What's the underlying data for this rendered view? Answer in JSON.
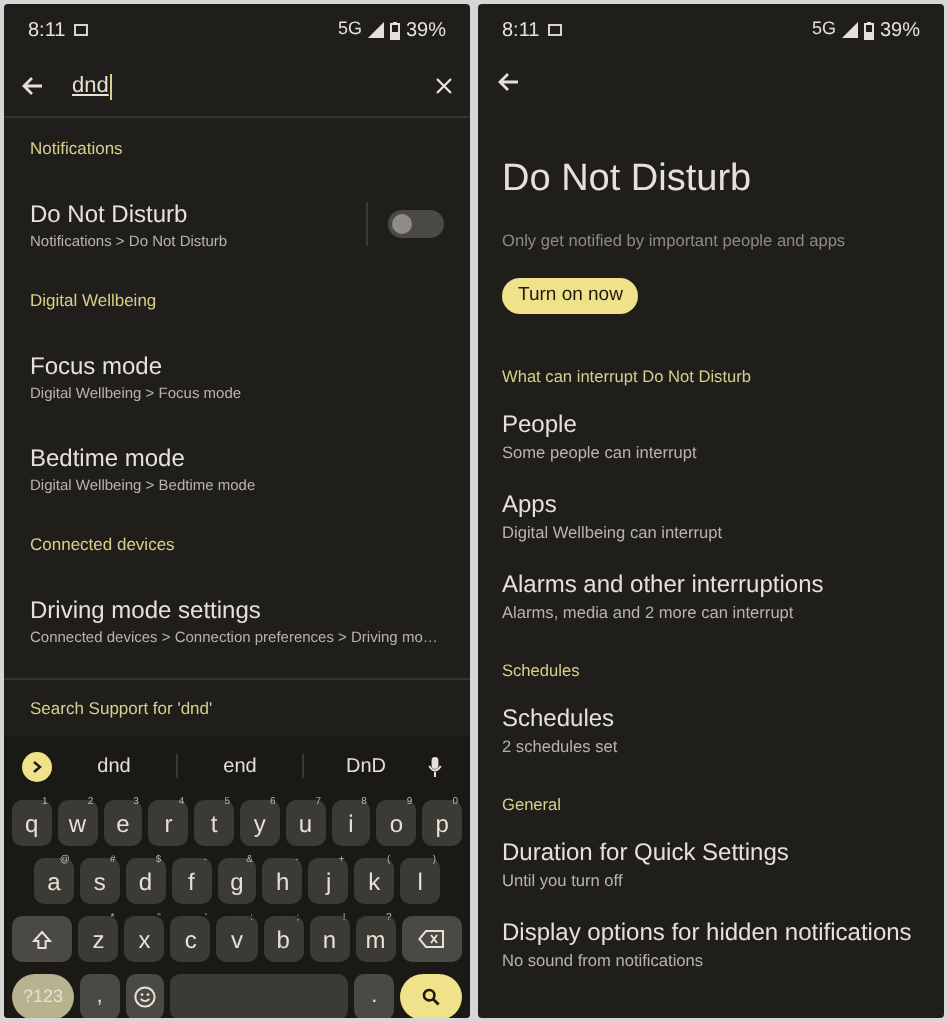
{
  "search_screen": {
    "status_bar": {
      "time": "8:11",
      "network": "5G",
      "battery": "39%"
    },
    "search": {
      "value": "dnd"
    },
    "results": [
      {
        "kind": "heading",
        "text": "Notifications"
      },
      {
        "kind": "toggle_item",
        "title": "Do Not Disturb",
        "subtitle": "Notifications > Do Not Disturb",
        "on": false
      },
      {
        "kind": "heading",
        "text": "Digital Wellbeing"
      },
      {
        "kind": "item",
        "title": "Focus mode",
        "subtitle": "Digital Wellbeing > Focus mode"
      },
      {
        "kind": "item",
        "title": "Bedtime mode",
        "subtitle": "Digital Wellbeing > Bedtime mode"
      },
      {
        "kind": "heading",
        "text": "Connected devices"
      },
      {
        "kind": "item",
        "title": "Driving mode settings",
        "subtitle": "Connected devices > Connection preferences > Driving mo…"
      }
    ],
    "support_link": "Search Support for 'dnd'",
    "keyboard": {
      "suggestions": [
        "dnd",
        "end",
        "DnD"
      ],
      "rows": [
        {
          "keys": [
            {
              "kind": "letter",
              "label": "q",
              "hint": "1"
            },
            {
              "kind": "letter",
              "label": "w",
              "hint": "2"
            },
            {
              "kind": "letter",
              "label": "e",
              "hint": "3"
            },
            {
              "kind": "letter",
              "label": "r",
              "hint": "4"
            },
            {
              "kind": "letter",
              "label": "t",
              "hint": "5"
            },
            {
              "kind": "letter",
              "label": "y",
              "hint": "6"
            },
            {
              "kind": "letter",
              "label": "u",
              "hint": "7"
            },
            {
              "kind": "letter",
              "label": "i",
              "hint": "8"
            },
            {
              "kind": "letter",
              "label": "o",
              "hint": "9"
            },
            {
              "kind": "letter",
              "label": "p",
              "hint": "0"
            }
          ]
        },
        {
          "keys": [
            {
              "kind": "letter",
              "label": "a",
              "hint": "@"
            },
            {
              "kind": "letter",
              "label": "s",
              "hint": "#"
            },
            {
              "kind": "letter",
              "label": "d",
              "hint": "$"
            },
            {
              "kind": "letter",
              "label": "f",
              "hint": "-"
            },
            {
              "kind": "letter",
              "label": "g",
              "hint": "&"
            },
            {
              "kind": "letter",
              "label": "h",
              "hint": "-"
            },
            {
              "kind": "letter",
              "label": "j",
              "hint": "+"
            },
            {
              "kind": "letter",
              "label": "k",
              "hint": "("
            },
            {
              "kind": "letter",
              "label": "l",
              "hint": ")"
            }
          ]
        },
        {
          "keys": [
            {
              "kind": "shift"
            },
            {
              "kind": "letter",
              "label": "z",
              "hint": "*"
            },
            {
              "kind": "letter",
              "label": "x",
              "hint": "\""
            },
            {
              "kind": "letter",
              "label": "c",
              "hint": "'"
            },
            {
              "kind": "letter",
              "label": "v",
              "hint": ":"
            },
            {
              "kind": "letter",
              "label": "b",
              "hint": ";"
            },
            {
              "kind": "letter",
              "label": "n",
              "hint": "!"
            },
            {
              "kind": "letter",
              "label": "m",
              "hint": "?"
            },
            {
              "kind": "backspace"
            }
          ]
        },
        {
          "keys": [
            {
              "kind": "symbols",
              "label": "?123"
            },
            {
              "kind": "char",
              "label": ","
            },
            {
              "kind": "emoji"
            },
            {
              "kind": "space"
            },
            {
              "kind": "char",
              "label": "."
            },
            {
              "kind": "search"
            }
          ]
        }
      ]
    }
  },
  "dnd_screen": {
    "status_bar": {
      "time": "8:11",
      "network": "5G",
      "battery": "39%"
    },
    "title": "Do Not Disturb",
    "description": "Only get notified by important people and apps",
    "button": "Turn on now",
    "sections": [
      {
        "heading": "What can interrupt Do Not Disturb",
        "items": [
          {
            "title": "People",
            "subtitle": "Some people can interrupt"
          },
          {
            "title": "Apps",
            "subtitle": "Digital Wellbeing can interrupt"
          },
          {
            "title": "Alarms and other interruptions",
            "subtitle": "Alarms, media and 2 more can interrupt"
          }
        ]
      },
      {
        "heading": "Schedules",
        "items": [
          {
            "title": "Schedules",
            "subtitle": "2 schedules set"
          }
        ]
      },
      {
        "heading": "General",
        "items": [
          {
            "title": "Duration for Quick Settings",
            "subtitle": "Until you turn off"
          },
          {
            "title": "Display options for hidden notifications",
            "subtitle": "No sound from notifications"
          }
        ]
      }
    ]
  }
}
